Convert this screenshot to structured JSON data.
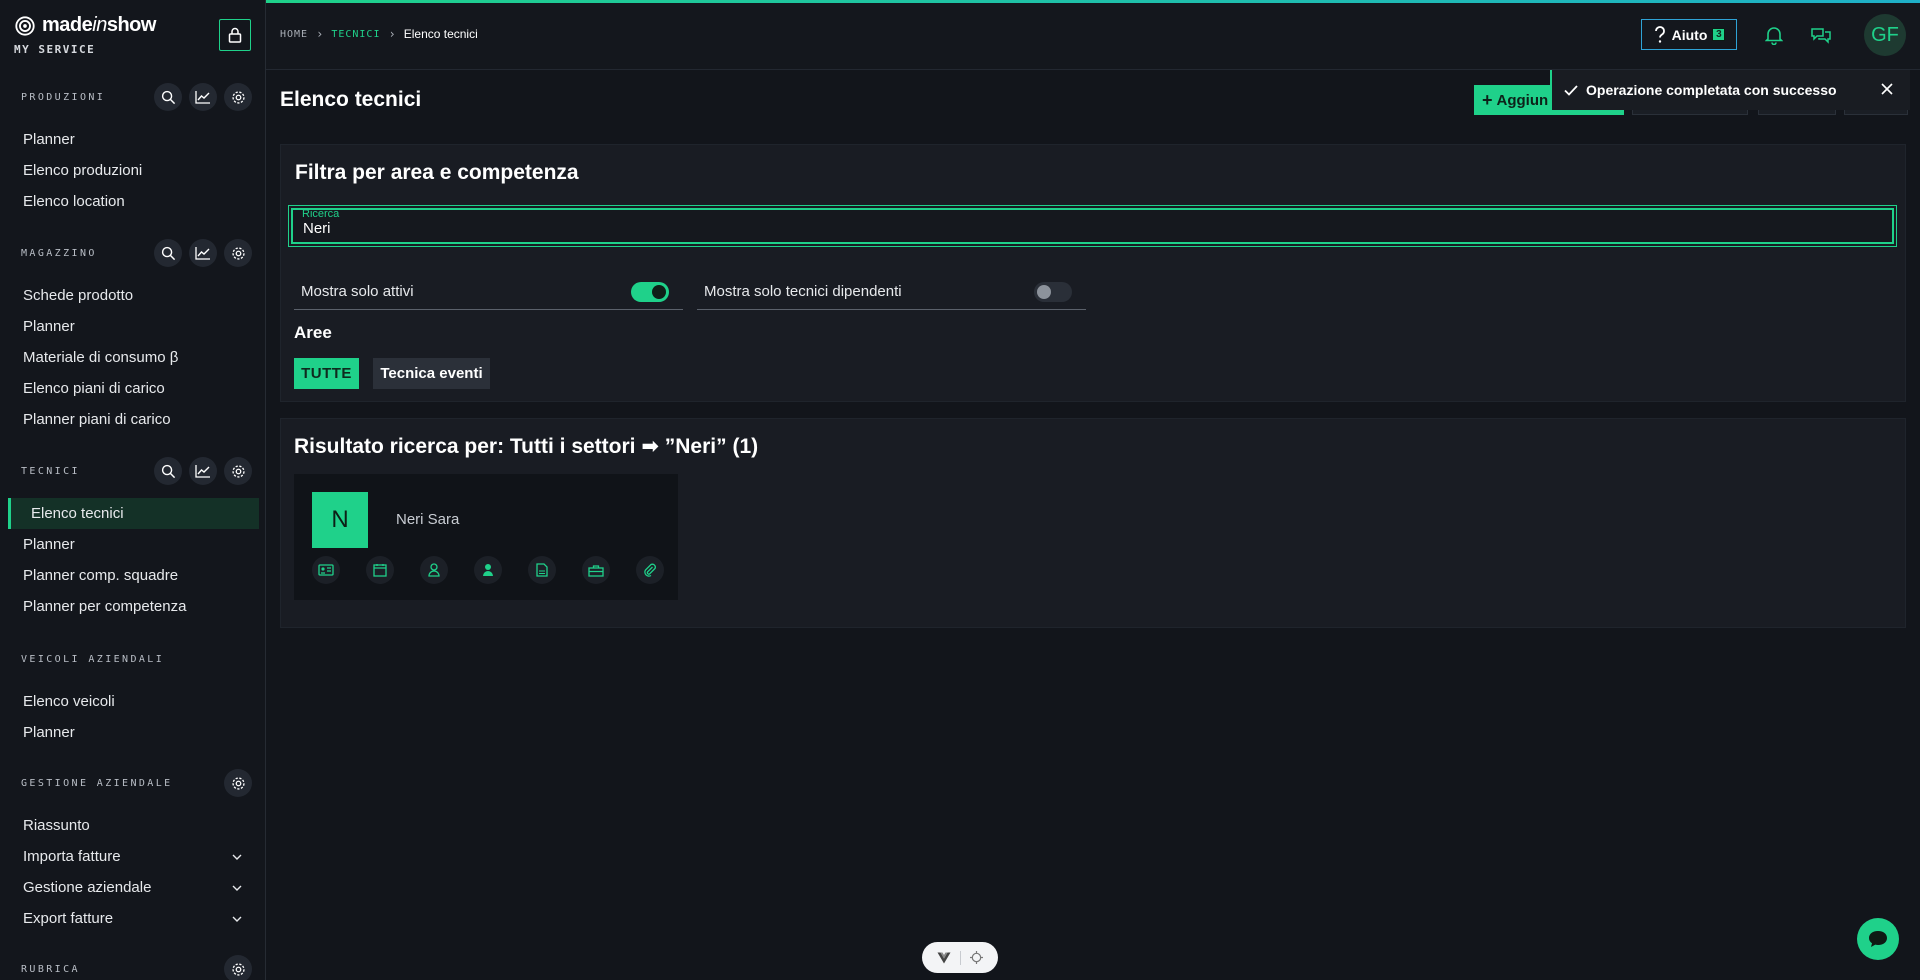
{
  "brand": {
    "name_a": "made",
    "name_b": "in",
    "name_c": "show",
    "subtitle": "MY SERVICE"
  },
  "sidebar": {
    "sections": [
      {
        "title": "PRODUZIONI",
        "items": [
          "Planner",
          "Elenco produzioni",
          "Elenco location"
        ]
      },
      {
        "title": "MAGAZZINO",
        "items": [
          "Schede prodotto",
          "Planner",
          "Materiale di consumo β",
          "Elenco piani di carico",
          "Planner piani di carico"
        ]
      },
      {
        "title": "TECNICI",
        "items": [
          "Elenco tecnici",
          "Planner",
          "Planner comp. squadre",
          "Planner per competenza"
        ]
      },
      {
        "title": "VEICOLI AZIENDALI",
        "items": [
          "Elenco veicoli",
          "Planner"
        ]
      },
      {
        "title": "GESTIONE AZIENDALE",
        "items": [
          "Riassunto",
          "Importa fatture",
          "Gestione aziendale",
          "Export fatture"
        ]
      },
      {
        "title": "RUBRICA"
      }
    ],
    "active_item": "Elenco tecnici"
  },
  "topbar": {
    "breadcrumb": [
      "HOME",
      "TECNICI",
      "Elenco tecnici"
    ],
    "help_label": "Aiuto",
    "help_badge": "3",
    "avatar_initials": "GF"
  },
  "page": {
    "title": "Elenco tecnici",
    "add_label": "Aggiun",
    "filter_title": "Filtra per area e competenza",
    "search_label": "Ricerca",
    "search_value": "Neri",
    "toggle_active_label": "Mostra solo attivi",
    "toggle_active_on": true,
    "toggle_employees_label": "Mostra solo tecnici dipendenti",
    "toggle_employees_on": false,
    "areas_title": "Aree",
    "chip_all": "TUTTE",
    "chip_events": "Tecnica eventi",
    "result_title": "Risultato ricerca per: Tutti i settori ➡ ”Neri” (1)",
    "technician": {
      "initial": "N",
      "name": "Neri Sara"
    }
  },
  "toast": {
    "message": "Operazione completata con successo"
  },
  "colors": {
    "accent": "#1fd18a",
    "background": "#12151b",
    "panel": "#191c23"
  }
}
